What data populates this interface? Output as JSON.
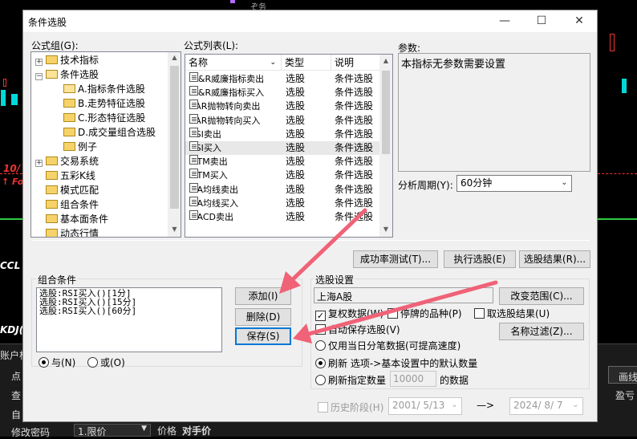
{
  "background": {
    "top_text": "ぞ务",
    "chart_red_labels": [
      "10/",
      "↑ Fo",
      "CCL",
      "KDJ("
    ],
    "bottom_left": [
      "账户栏",
      "点",
      "查",
      "自",
      "修改密码"
    ],
    "bottom_bar": {
      "order_type": "1.限价",
      "price_label": "价格",
      "price_value": "对手价"
    },
    "right_buttons": [
      "画线",
      "盈亏"
    ]
  },
  "dialog": {
    "title": "条件选股",
    "controls": {
      "minimize": "—",
      "maximize": "☐",
      "close": "✕"
    }
  },
  "formula_group": {
    "label": "公式组(G):",
    "items": [
      {
        "text": "技术指标",
        "level": 0,
        "expander": "+"
      },
      {
        "text": "条件选股",
        "level": 0,
        "expander": "−"
      },
      {
        "text": "A.指标条件选股",
        "level": 1,
        "selected": true
      },
      {
        "text": "B.走势特征选股",
        "level": 1
      },
      {
        "text": "C.形态特征选股",
        "level": 1
      },
      {
        "text": "D.成交量组合选股",
        "level": 1
      },
      {
        "text": "例子",
        "level": 1
      },
      {
        "text": "交易系统",
        "level": 0,
        "expander": "+"
      },
      {
        "text": "五彩K线",
        "level": 0
      },
      {
        "text": "模式匹配",
        "level": 0
      },
      {
        "text": "组合条件",
        "level": 0
      },
      {
        "text": "基本面条件",
        "level": 0
      },
      {
        "text": "动态行情",
        "level": 0
      }
    ]
  },
  "formula_list": {
    "label": "公式列表(L):",
    "columns": [
      "名称",
      "类型",
      "说明"
    ],
    "rows": [
      {
        "name": "W&R威廉指标卖出",
        "type": "选股",
        "desc": "条件选股"
      },
      {
        "name": "W&R威廉指标买入",
        "type": "选股",
        "desc": "条件选股"
      },
      {
        "name": "SAR抛物转向卖出",
        "type": "选股",
        "desc": "条件选股"
      },
      {
        "name": "SAR抛物转向买入",
        "type": "选股",
        "desc": "条件选股"
      },
      {
        "name": "RSI卖出",
        "type": "选股",
        "desc": "条件选股"
      },
      {
        "name": "RSI买入",
        "type": "选股",
        "desc": "条件选股",
        "selected": true
      },
      {
        "name": "MTM卖出",
        "type": "选股",
        "desc": "条件选股"
      },
      {
        "name": "MTM买入",
        "type": "选股",
        "desc": "条件选股"
      },
      {
        "name": "MA均线卖出",
        "type": "选股",
        "desc": "条件选股"
      },
      {
        "name": "MA均线买入",
        "type": "选股",
        "desc": "条件选股"
      },
      {
        "name": "MACD卖出",
        "type": "选股",
        "desc": "条件选股"
      }
    ]
  },
  "params": {
    "label": "参数:",
    "text": "本指标无参数需要设置"
  },
  "period": {
    "label": "分析周期(Y):",
    "value": "60分钟"
  },
  "action_buttons": {
    "backtest": "成功率测试(T)...",
    "run": "执行选股(E)",
    "results": "选股结果(R)..."
  },
  "combo_conditions": {
    "title": "组合条件",
    "lines": [
      "选股:RSI买入()[1分]",
      "选股:RSI买入()[15分]",
      "选股:RSI买入()[60分]"
    ],
    "add": "添加(I)",
    "delete": "删除(D)",
    "save": "保存(S)",
    "and_label": "与(N)",
    "or_label": "或(O)"
  },
  "settings": {
    "title": "选股设置",
    "scope_value": "上海A股",
    "change_scope": "改变范围(C)...",
    "reweight": "复权数据(W)",
    "suspended": "停牌的品种(P)",
    "prev_result": "取选股结果(U)",
    "autosave": "自动保存选股(V)",
    "name_filter": "名称过滤(Z)...",
    "opt_today": "仅用当日分笔数据(可提高速度)",
    "opt_refresh_default": "刷新 选项->基本设置中的默认数量",
    "opt_refresh_count_a": "刷新指定数量",
    "count_value": "10000",
    "opt_refresh_count_b": "的数据",
    "history": "历史阶段(H)",
    "date_from": "2001/ 5/13",
    "arrow": "—>",
    "date_to": "2024/ 8/ 7"
  }
}
